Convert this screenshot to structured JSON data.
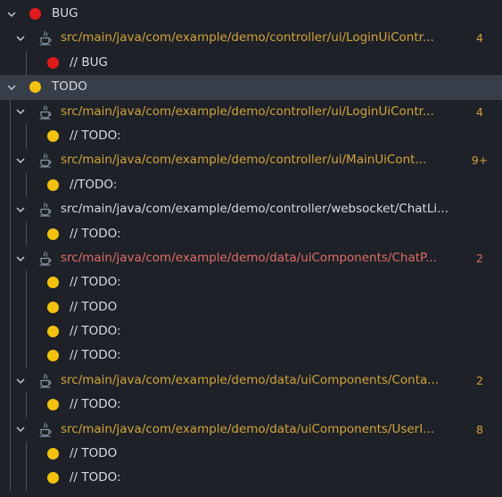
{
  "groups": [
    {
      "label": "BUG",
      "dot_color": "#e11b1b",
      "files": [
        {
          "path": "src/main/java/com/example/demo/controller/ui/LoginUiContr...",
          "badge": "4",
          "status": "modified",
          "items": [
            "// BUG"
          ]
        }
      ]
    },
    {
      "label": "TODO",
      "dot_color": "#f4c20d",
      "files": [
        {
          "path": "src/main/java/com/example/demo/controller/ui/LoginUiContr...",
          "badge": "4",
          "status": "modified",
          "items": [
            "// TODO:"
          ]
        },
        {
          "path": "src/main/java/com/example/demo/controller/ui/MainUiCont...",
          "badge": "9+",
          "status": "modified",
          "items": [
            "//TODO:"
          ]
        },
        {
          "path": "src/main/java/com/example/demo/controller/websocket/ChatLi...",
          "badge": "",
          "status": "unchanged",
          "items": [
            "// TODO:"
          ]
        },
        {
          "path": "src/main/java/com/example/demo/data/uiComponents/ChatP...",
          "badge": "2",
          "status": "error",
          "items": [
            "// TODO:",
            "// TODO",
            "// TODO:",
            "// TODO:"
          ]
        },
        {
          "path": "src/main/java/com/example/demo/data/uiComponents/Conta...",
          "badge": "2",
          "status": "modified",
          "items": [
            "// TODO:"
          ]
        },
        {
          "path": "src/main/java/com/example/demo/data/uiComponents/UserI...",
          "badge": "8",
          "status": "modified",
          "items": [
            "// TODO",
            "// TODO:"
          ]
        }
      ]
    }
  ],
  "selected_group": "TODO",
  "colors": {
    "background": "#1e2228",
    "selected_row": "#383e49",
    "modified": "#d2a23a",
    "error": "#e06c65",
    "text": "#d7dae0"
  },
  "icons": {
    "expand": "chevron-down-icon",
    "file": "java-file-icon",
    "marker": "dot-icon"
  }
}
